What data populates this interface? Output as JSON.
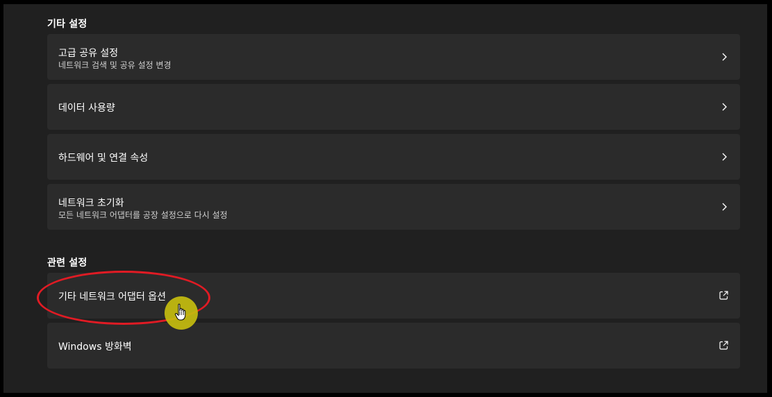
{
  "other_settings": {
    "heading": "기타 설정",
    "items": [
      {
        "title": "고급 공유 설정",
        "subtitle": "네트워크 검색 및 공유 설정 변경",
        "icon": "chevron-right-icon"
      },
      {
        "title": "데이터 사용량",
        "icon": "chevron-right-icon"
      },
      {
        "title": "하드웨어 및 연결 속성",
        "icon": "chevron-right-icon"
      },
      {
        "title": "네트워크 초기화",
        "subtitle": "모든 네트워크 어댑터를 공장 설정으로 다시 설정",
        "icon": "chevron-right-icon"
      }
    ]
  },
  "related_settings": {
    "heading": "관련 설정",
    "items": [
      {
        "title": "기타 네트워크 어댑터 옵션",
        "icon": "external-link-icon"
      },
      {
        "title": "Windows 방화벽",
        "icon": "external-link-icon"
      }
    ]
  },
  "colors": {
    "background": "#202020",
    "card": "#2b2b2b",
    "annotation": "#e01b24",
    "cursor_highlight": "#c6bd0f"
  }
}
